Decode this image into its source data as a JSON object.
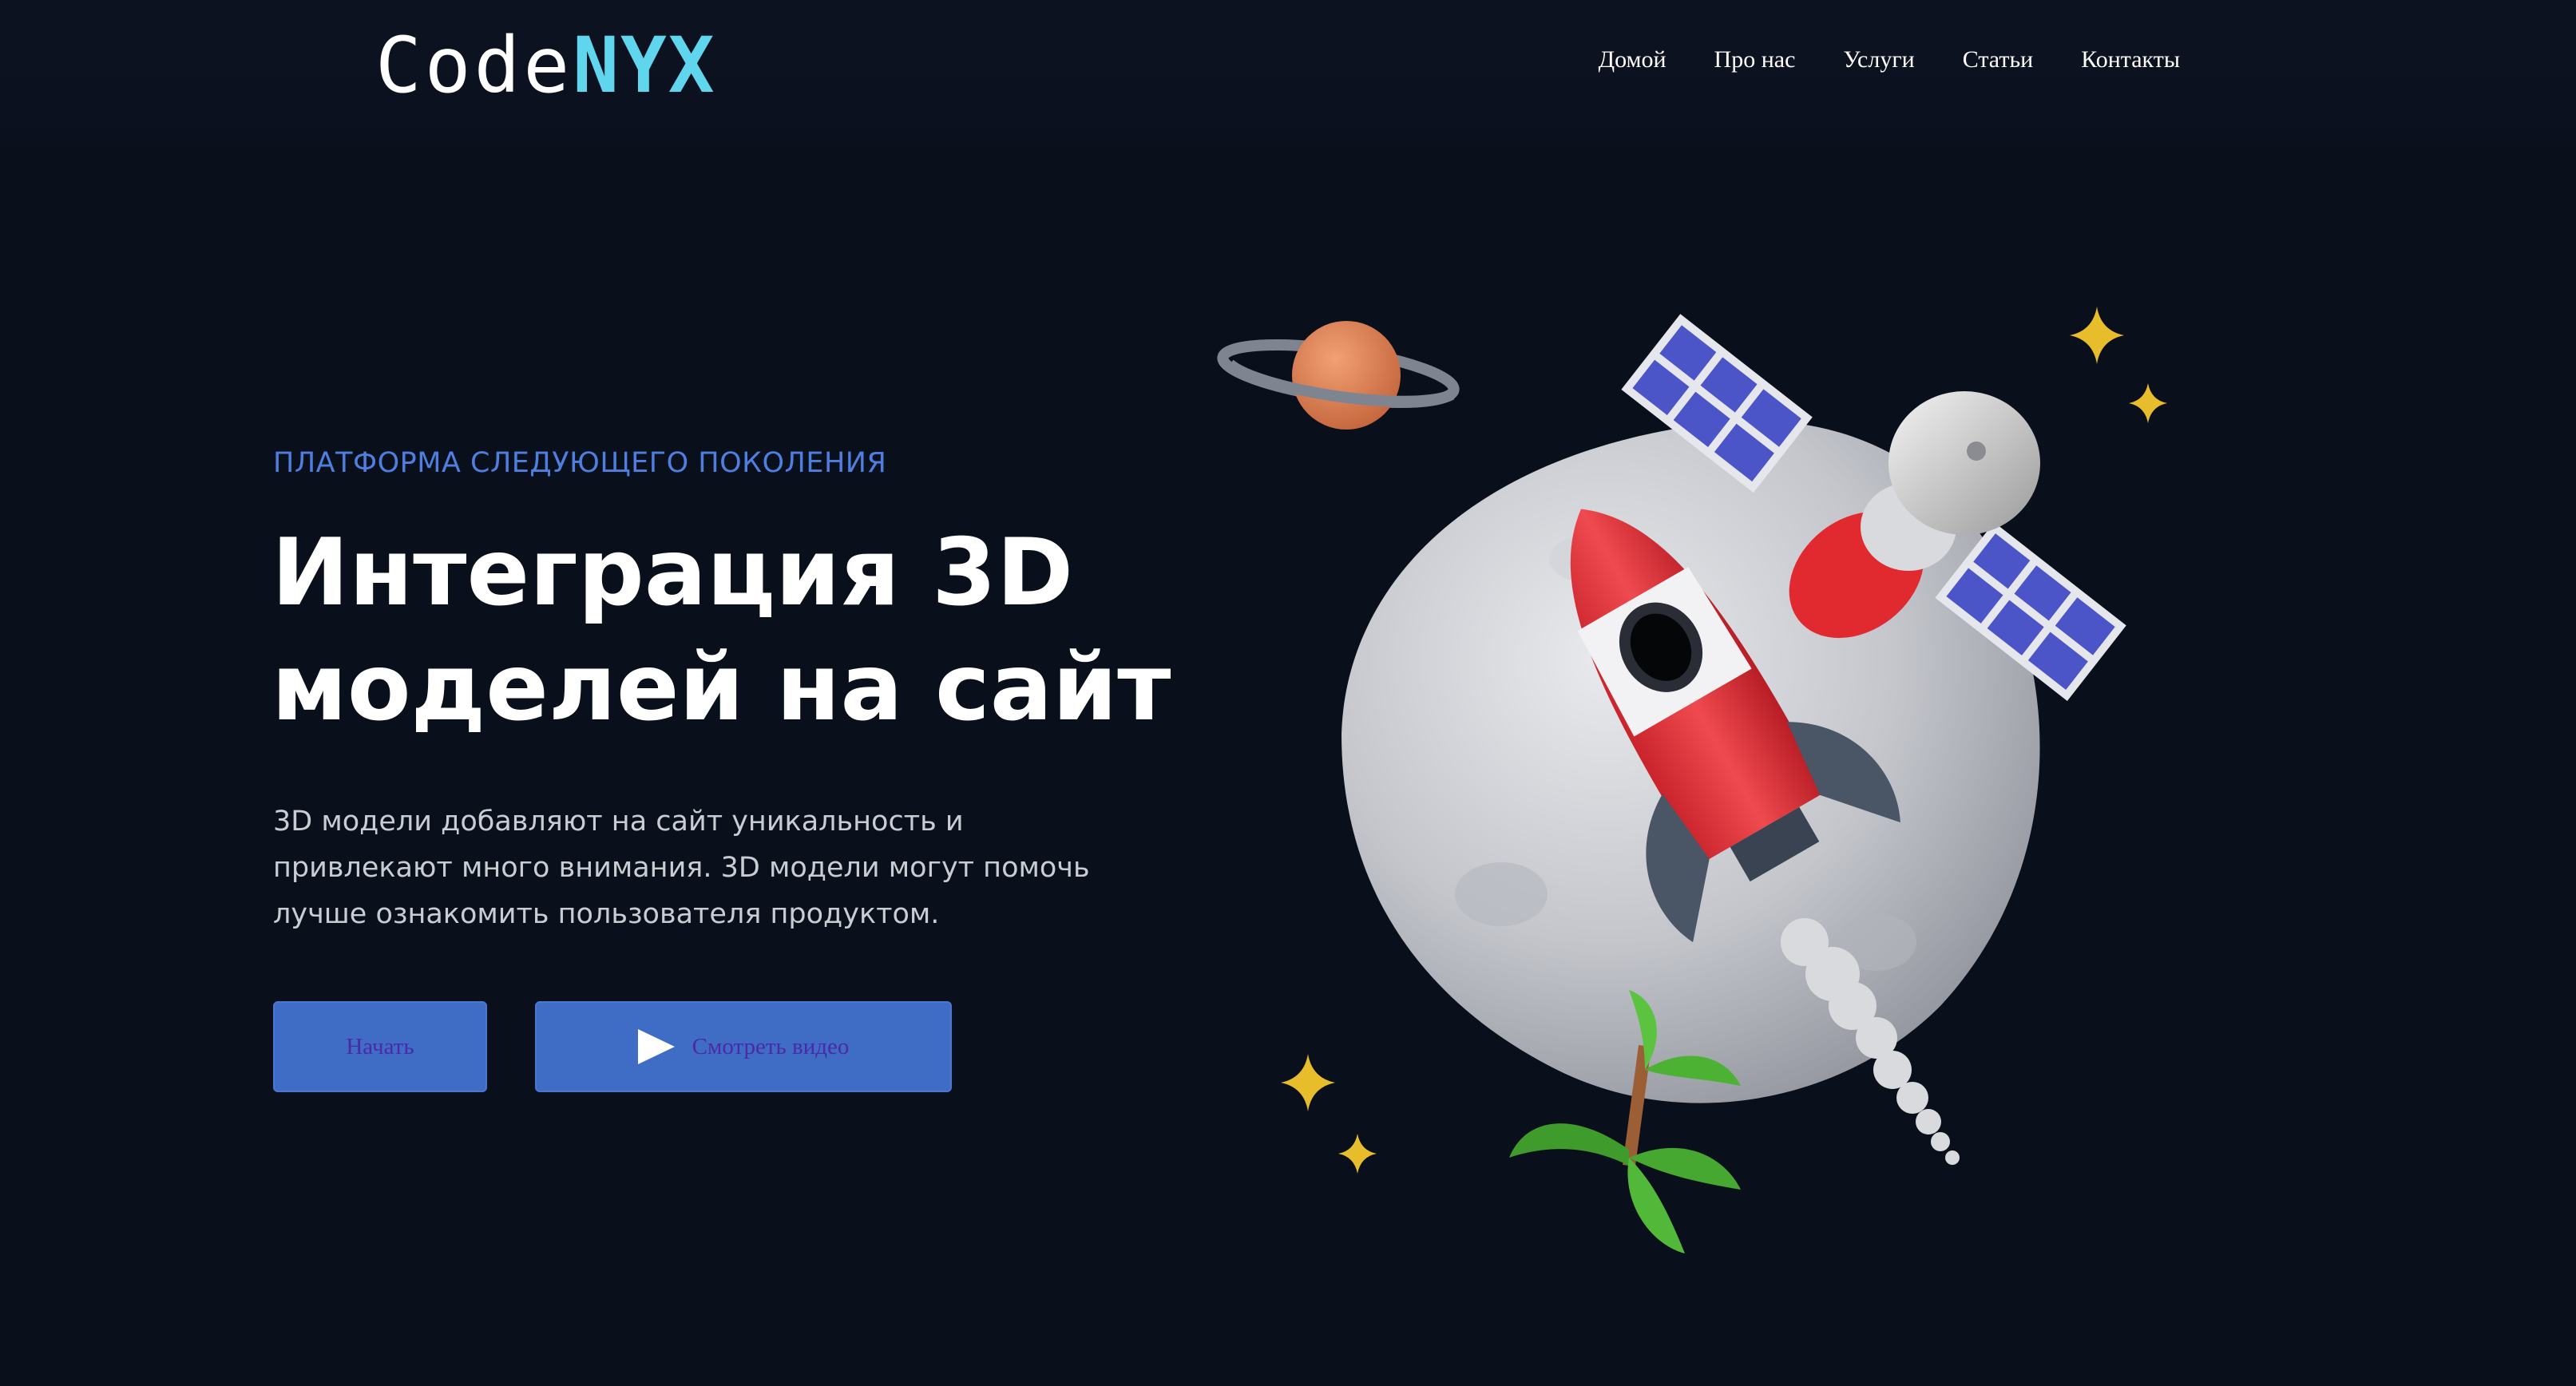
{
  "header": {
    "logo": {
      "part1": "Code",
      "part2": "NYX"
    },
    "nav": [
      {
        "label": "Домой"
      },
      {
        "label": "Про нас"
      },
      {
        "label": "Услуги"
      },
      {
        "label": "Статьи"
      },
      {
        "label": "Контакты"
      }
    ]
  },
  "hero": {
    "eyebrow": "ПЛАТФОРМА СЛЕДУЮЩЕГО ПОКОЛЕНИЯ",
    "title_line1": "Интеграция 3D",
    "title_line2": "моделей на сайт",
    "description": "3D модели добавляют на сайт уникальность и привлекают много внимания. 3D модели могут помочь лучше ознакомить пользователя продуктом.",
    "start_button": "Начать",
    "video_button": "Смотреть видео"
  },
  "illustration": {
    "icons": [
      "planet-icon",
      "moon-icon",
      "rocket-icon",
      "satellite-icon",
      "palm-tree-icon",
      "sparkle-star-icon"
    ]
  },
  "colors": {
    "background": "#0a0f1c",
    "accent": "#4d7fe0",
    "button": "#3f6cc4",
    "button_text": "#4b2aa5",
    "logo_accent": "#5fd6ee"
  }
}
